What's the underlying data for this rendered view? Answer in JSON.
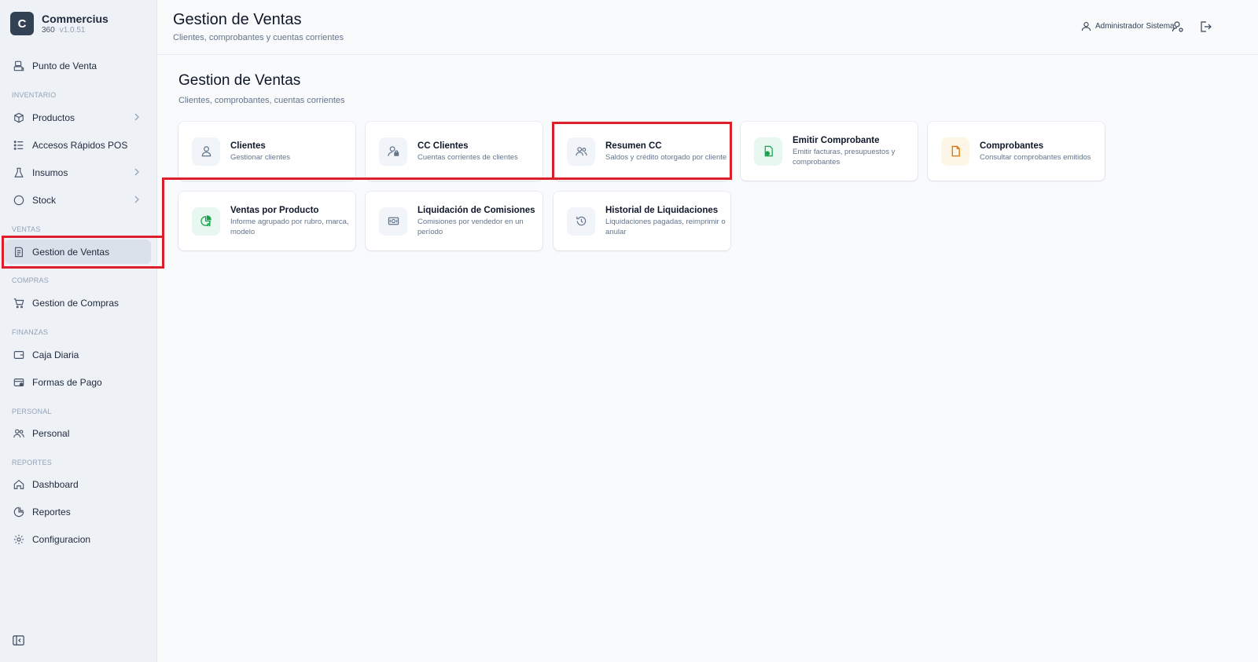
{
  "brand": {
    "logo_letter": "C",
    "name": "Commercius",
    "sub": "360",
    "version": "v1.0.51"
  },
  "sidebar": {
    "items": [
      {
        "label": "Punto de Venta",
        "icon": "pos-icon"
      },
      {
        "label": "Productos",
        "icon": "box-icon"
      },
      {
        "label": "Accesos Rápidos POS",
        "icon": "list-icon"
      },
      {
        "label": "Insumos",
        "icon": "flask-icon"
      },
      {
        "label": "Stock",
        "icon": "circle-icon"
      },
      {
        "label": "Gestion de Ventas",
        "icon": "receipt-icon"
      },
      {
        "label": "Gestion de Compras",
        "icon": "cart-icon"
      },
      {
        "label": "Caja Diaria",
        "icon": "wallet-icon"
      },
      {
        "label": "Formas de Pago",
        "icon": "card-icon"
      },
      {
        "label": "Personal",
        "icon": "users-icon"
      },
      {
        "label": "Dashboard",
        "icon": "home-icon"
      },
      {
        "label": "Reportes",
        "icon": "report-icon"
      },
      {
        "label": "Configuracion",
        "icon": "gear-icon"
      }
    ],
    "sections": {
      "inventario": "INVENTARIO",
      "ventas": "VENTAS",
      "compras": "COMPRAS",
      "finanzas": "FINANZAS",
      "personal": "PERSONAL",
      "reportes": "REPORTES"
    }
  },
  "header": {
    "title": "Gestion de Ventas",
    "subtitle": "Clientes, comprobantes y cuentas corrientes",
    "user": "Administrador Sistema"
  },
  "main": {
    "title": "Gestion de Ventas",
    "subtitle": "Clientes, comprobantes, cuentas corrientes",
    "cards": [
      {
        "title": "Clientes",
        "desc": "Gestionar clientes"
      },
      {
        "title": "CC Clientes",
        "desc": "Cuentas corrientes de clientes"
      },
      {
        "title": "Resumen CC",
        "desc": "Saldos y crédito otorgado por cliente"
      },
      {
        "title": "Emitir Comprobante",
        "desc": "Emitir facturas, presupuestos y comprobantes"
      },
      {
        "title": "Comprobantes",
        "desc": "Consultar comprobantes emitidos"
      },
      {
        "title": "Ventas por Producto",
        "desc": "Informe agrupado por rubro, marca, modelo"
      },
      {
        "title": "Liquidación de Comisiones",
        "desc": "Comisiones por vendedor en un período"
      },
      {
        "title": "Historial de Liquidaciones",
        "desc": "Liquidaciones pagadas, reimprimir o anular"
      }
    ]
  },
  "colors": {
    "highlight": "#dc1f2a",
    "active_bg": "#dbe1ea",
    "green_accent": "#16a34a",
    "amber_accent": "#d97706"
  }
}
